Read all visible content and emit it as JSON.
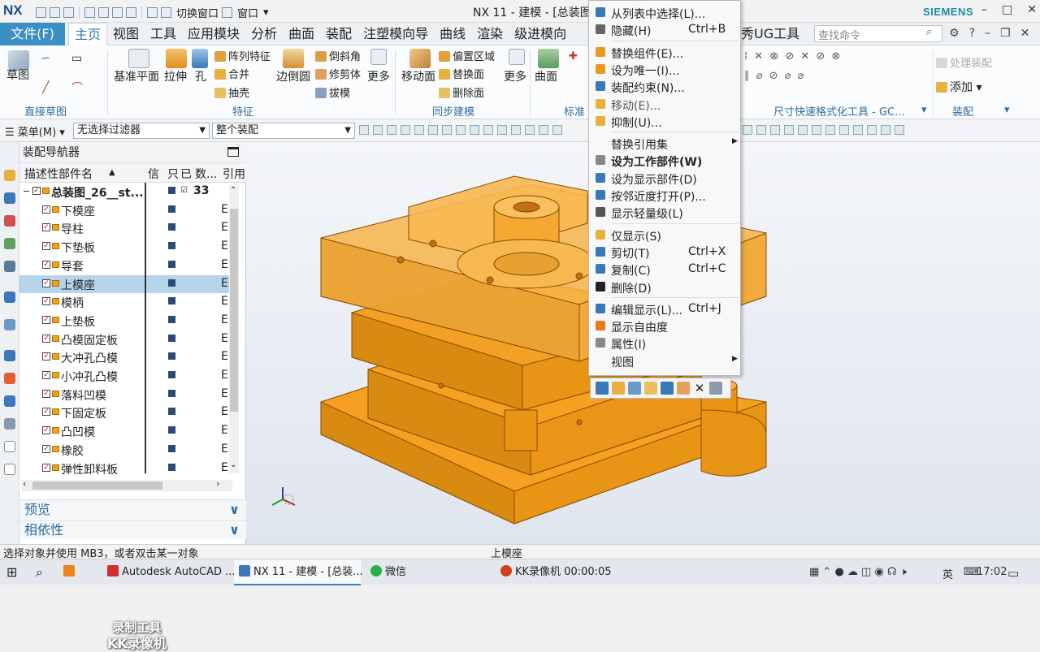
{
  "title_bar": {
    "logo": "NX",
    "switch_window": "切换窗口",
    "window_menu": "窗口",
    "window_title": "NX 11 - 建模 - [总装图",
    "brand": "SIEMENS",
    "controls": [
      "–",
      "□",
      "✕"
    ]
  },
  "menubar": {
    "file_tab": "文件(F)",
    "tabs": [
      "主页",
      "视图",
      "工具",
      "应用模块",
      "分析",
      "曲面",
      "装配",
      "注塑模向导",
      "曲线",
      "渲染",
      "级进模向"
    ],
    "active_tab": "主页",
    "tab_right": "秀UG工具",
    "search_placeholder": "查找命令",
    "right_icons": [
      "⚙",
      "?",
      "–",
      "❐",
      "✕"
    ]
  },
  "ribbon": {
    "sketch": "草图",
    "direct_sketch_group": "直接草图",
    "datum_plane": "基准平面",
    "extrude": "拉伸",
    "hole": "孔",
    "pattern_feature": "阵列特征",
    "unite": "合并",
    "shell": "抽壳",
    "edge_blend": "边倒圆",
    "chamfer": "倒斜角",
    "trim_body": "修剪体",
    "draft": "拔模",
    "more1": "更多",
    "feature_group": "特征",
    "move_face": "移动面",
    "offset_region": "偏置区域",
    "replace_face": "替换面",
    "delete_face": "删除面",
    "more2": "更多",
    "sync_group": "同步建模",
    "surface": "曲面",
    "std_group": "标准",
    "dim_tool_group": "尺寸快速格式化工具 - GC...",
    "process_assembly": "处理装配",
    "add": "添加",
    "assembly_group": "装配"
  },
  "selection_bar": {
    "menu": "菜单(M)",
    "filter": "无选择过滤器",
    "scope": "整个装配"
  },
  "navigator": {
    "title": "装配导航器",
    "columns": [
      "描述性部件名",
      "信",
      "只",
      "已",
      "数...",
      "引用"
    ],
    "root": {
      "name": "总装图_26__st...",
      "count": "33"
    },
    "parts": [
      "下模座",
      "导柱",
      "下垫板",
      "导套",
      "上模座",
      "模柄",
      "上垫板",
      "凸模固定板",
      "大冲孔凸模",
      "小冲孔凸模",
      "落料凹模",
      "下固定板",
      "凸凹模",
      "橡胶",
      "弹性卸料板"
    ],
    "ref_value": "E",
    "selected_part": "上模座",
    "sections": [
      "预览",
      "相依性"
    ],
    "watermark": [
      "录制工具",
      "KK录像机"
    ]
  },
  "context_menu": {
    "items": [
      {
        "label": "从列表中选择(L)...",
        "shortcut": "",
        "icon_color": "#3a78b8",
        "style": "normal"
      },
      {
        "label": "隐藏(H)",
        "shortcut": "Ctrl+B",
        "icon_color": "#666666",
        "style": "normal"
      },
      {
        "label": "替换组件(E)...",
        "shortcut": "",
        "icon_color": "#e89a20",
        "style": "normal"
      },
      {
        "label": "设为唯一(I)...",
        "shortcut": "",
        "icon_color": "#e89a20",
        "style": "normal"
      },
      {
        "label": "装配约束(N)...",
        "shortcut": "",
        "icon_color": "#3a78b8",
        "style": "normal"
      },
      {
        "label": "移动(E)...",
        "shortcut": "",
        "icon_color": "#e8b040",
        "style": "dis"
      },
      {
        "label": "抑制(U)...",
        "shortcut": "",
        "icon_color": "#e8b040",
        "style": "normal"
      },
      {
        "label": "替换引用集",
        "shortcut": "",
        "icon_color": "",
        "style": "sub"
      },
      {
        "label": "设为工作部件(W)",
        "shortcut": "",
        "icon_color": "#888888",
        "style": "bold"
      },
      {
        "label": "设为显示部件(D)",
        "shortcut": "",
        "icon_color": "#3a78b8",
        "style": "normal"
      },
      {
        "label": "按邻近度打开(P)...",
        "shortcut": "",
        "icon_color": "#3a78b8",
        "style": "normal"
      },
      {
        "label": "显示轻量级(L)",
        "shortcut": "",
        "icon_color": "#555555",
        "style": "normal"
      },
      {
        "label": "仅显示(S)",
        "shortcut": "",
        "icon_color": "#e8b040",
        "style": "normal"
      },
      {
        "label": "剪切(T)",
        "shortcut": "Ctrl+X",
        "icon_color": "#3a78b8",
        "style": "normal"
      },
      {
        "label": "复制(C)",
        "shortcut": "Ctrl+C",
        "icon_color": "#3a78b8",
        "style": "normal"
      },
      {
        "label": "删除(D)",
        "shortcut": "",
        "icon_color": "#222222",
        "style": "normal"
      },
      {
        "label": "编辑显示(L)...",
        "shortcut": "Ctrl+J",
        "icon_color": "#3a78b8",
        "style": "normal"
      },
      {
        "label": "显示自由度",
        "shortcut": "",
        "icon_color": "#e87a20",
        "style": "normal"
      },
      {
        "label": "属性(I)",
        "shortcut": "",
        "icon_color": "#888888",
        "style": "normal"
      },
      {
        "label": "视图",
        "shortcut": "",
        "icon_color": "",
        "style": "sub"
      }
    ]
  },
  "status_bar": {
    "prompt": "选择对象并使用 MB3，或者双击某一对象",
    "selection": "上模座"
  },
  "taskbar": {
    "apps": [
      "Autodesk AutoCAD ...",
      "NX 11 - 建模 - [总装...",
      "微信",
      "KK录像机 00:00:05"
    ],
    "ime": "英",
    "time": "17:02"
  },
  "colors": {
    "accent": "#3b8fc4",
    "part_orange": "#f5a020",
    "selection": "#b6d4ea"
  }
}
